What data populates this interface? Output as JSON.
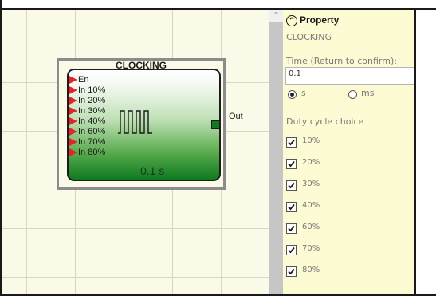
{
  "block": {
    "title": "CLOCKING",
    "inputs": [
      "En",
      "In 10%",
      "In 20%",
      "In 30%",
      "In 40%",
      "In 60%",
      "In 70%",
      "In 80%"
    ],
    "output": "Out",
    "time_display": "0.1 s"
  },
  "panel": {
    "header": "Property",
    "subtitle": "CLOCKING",
    "time_label": "Time (Return to confirm):",
    "time_value": "0.1",
    "unit_s": "s",
    "unit_ms": "ms",
    "selected_unit": "s",
    "duty_label": "Duty cycle choice",
    "duty_options": [
      {
        "label": "10%",
        "checked": true
      },
      {
        "label": "20%",
        "checked": true
      },
      {
        "label": "30%",
        "checked": true
      },
      {
        "label": "40%",
        "checked": true
      },
      {
        "label": "60%",
        "checked": true
      },
      {
        "label": "70%",
        "checked": true
      },
      {
        "label": "80%",
        "checked": true
      }
    ]
  },
  "colors": {
    "canvas_bg": "#fbf9e7",
    "panel_bg": "#fdfbd4",
    "block_green": "#0f7a20",
    "input_marker": "#e0262b"
  }
}
